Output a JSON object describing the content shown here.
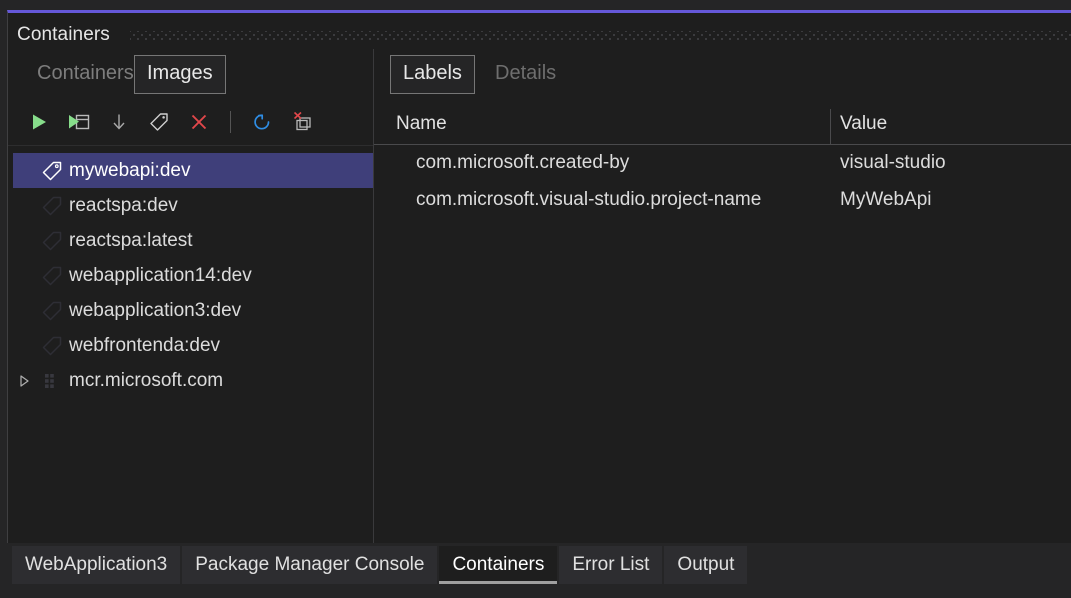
{
  "window": {
    "title": "Containers",
    "accent_color": "#6558d9",
    "background": "#1e1e1e",
    "drag_handle_name": "drag-handle-dots"
  },
  "left_pane": {
    "pivots": [
      {
        "label": "Containers",
        "active": false
      },
      {
        "label": "Images",
        "active": true
      }
    ],
    "toolbar": [
      {
        "name": "run-button",
        "icon": "play-icon",
        "tooltipish": "Run"
      },
      {
        "name": "run-interactive-button",
        "icon": "play-window-icon",
        "tooltipish": "Run Interactive"
      },
      {
        "name": "pull-button",
        "icon": "arrow-down-icon",
        "tooltipish": "Pull"
      },
      {
        "name": "tag-button",
        "icon": "tag-icon",
        "tooltipish": "Tag"
      },
      {
        "name": "remove-button",
        "icon": "close-x-icon",
        "tooltipish": "Remove"
      },
      {
        "name": "separator",
        "icon": "separator",
        "tooltipish": ""
      },
      {
        "name": "refresh-button",
        "icon": "refresh-icon",
        "tooltipish": "Refresh"
      },
      {
        "name": "prune-button",
        "icon": "prune-images-icon",
        "tooltipish": "Prune"
      }
    ],
    "tree": [
      {
        "label": "mywebapi:dev",
        "icon": "tag-icon",
        "selected": true,
        "expandable": false
      },
      {
        "label": "reactspa:dev",
        "icon": "tag-icon",
        "selected": false,
        "expandable": false
      },
      {
        "label": "reactspa:latest",
        "icon": "tag-icon",
        "selected": false,
        "expandable": false
      },
      {
        "label": "webapplication14:dev",
        "icon": "tag-icon",
        "selected": false,
        "expandable": false
      },
      {
        "label": "webapplication3:dev",
        "icon": "tag-icon",
        "selected": false,
        "expandable": false
      },
      {
        "label": "webfrontenda:dev",
        "icon": "tag-icon",
        "selected": false,
        "expandable": false
      },
      {
        "label": "mcr.microsoft.com",
        "icon": "registry-icon",
        "selected": false,
        "expandable": true
      }
    ],
    "selection_color": "#3f3f7a"
  },
  "right_pane": {
    "pivots": [
      {
        "label": "Labels",
        "active": true
      },
      {
        "label": "Details",
        "active": false
      }
    ],
    "grid": {
      "columns": [
        "Name",
        "Value"
      ],
      "rows": [
        {
          "name": "com.microsoft.created-by",
          "value": "visual-studio"
        },
        {
          "name": "com.microsoft.visual-studio.project-name",
          "value": "MyWebApi"
        }
      ]
    }
  },
  "bottom_tabs": [
    {
      "label": "WebApplication3",
      "active": false
    },
    {
      "label": "Package Manager Console",
      "active": false
    },
    {
      "label": "Containers",
      "active": true
    },
    {
      "label": "Error List",
      "active": false
    },
    {
      "label": "Output",
      "active": false
    }
  ]
}
